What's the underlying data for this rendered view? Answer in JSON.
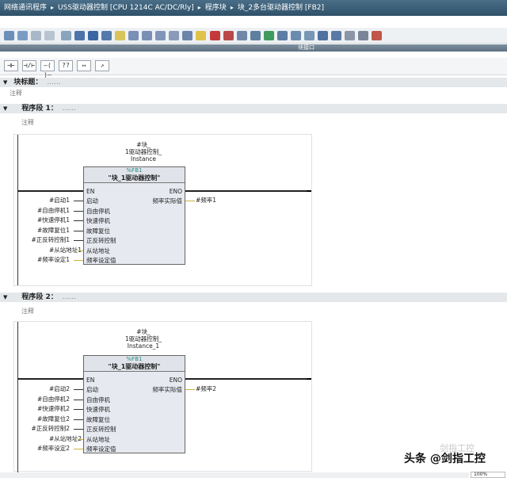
{
  "breadcrumb": {
    "items": [
      "网络通讯程序",
      "USS驱动器控制 [CPU 1214C AC/DC/Rly]",
      "程序块",
      "块_2多台驱动器控制 [FB2]"
    ],
    "separator": "▸"
  },
  "interface_bar": {
    "label": "块接口"
  },
  "ladder_toolbar": {
    "buttons": [
      "⊣⊢",
      "⊣/⊢",
      "–( )–",
      "??",
      "↦",
      "↗"
    ]
  },
  "block_title": {
    "label": "块标题：",
    "dots": "......",
    "comment": "注释"
  },
  "networks": [
    {
      "label": "程序段 1：",
      "dots": "......",
      "comment": "注释",
      "instance": [
        "#块_",
        "1驱动器控制_",
        "Instance"
      ],
      "fb_number": "%FB1",
      "fb_name": "\"块_1驱动器控制\"",
      "en": "EN",
      "eno": "ENO",
      "inputs": [
        {
          "pin": "启动",
          "arg": "#启动1"
        },
        {
          "pin": "自由停机",
          "arg": "#自由停机1"
        },
        {
          "pin": "快速停机",
          "arg": "#快速停机1"
        },
        {
          "pin": "故障复位",
          "arg": "#故障复位1"
        },
        {
          "pin": "正反转控制",
          "arg": "#正反转控制1"
        },
        {
          "pin": "从站地址",
          "arg": "#从站地址1"
        },
        {
          "pin": "频率设定值",
          "arg": "#频率设定1"
        }
      ],
      "outputs": [
        {
          "pin": "频率实际值",
          "arg": "#频率1"
        }
      ]
    },
    {
      "label": "程序段 2：",
      "dots": "......",
      "comment": "注释",
      "instance": [
        "#块_",
        "1驱动器控制_",
        "Instance_1"
      ],
      "fb_number": "%FB1",
      "fb_name": "\"块_1驱动器控制\"",
      "en": "EN",
      "eno": "ENO",
      "inputs": [
        {
          "pin": "启动",
          "arg": "#启动2"
        },
        {
          "pin": "自由停机",
          "arg": "#自由停机2"
        },
        {
          "pin": "快速停机",
          "arg": "#快速停机2"
        },
        {
          "pin": "故障复位",
          "arg": "#故障复位2"
        },
        {
          "pin": "正反转控制",
          "arg": "#正反转控制2"
        },
        {
          "pin": "从站地址",
          "arg": "#从站地址2"
        },
        {
          "pin": "频率设定值",
          "arg": "#频率设定2"
        }
      ],
      "outputs": [
        {
          "pin": "频率实际值",
          "arg": "#频率2"
        }
      ]
    }
  ],
  "watermark": {
    "text": "头条 @剑指工控",
    "faint": "剑指工控"
  },
  "status": {
    "zoom": "100%"
  }
}
